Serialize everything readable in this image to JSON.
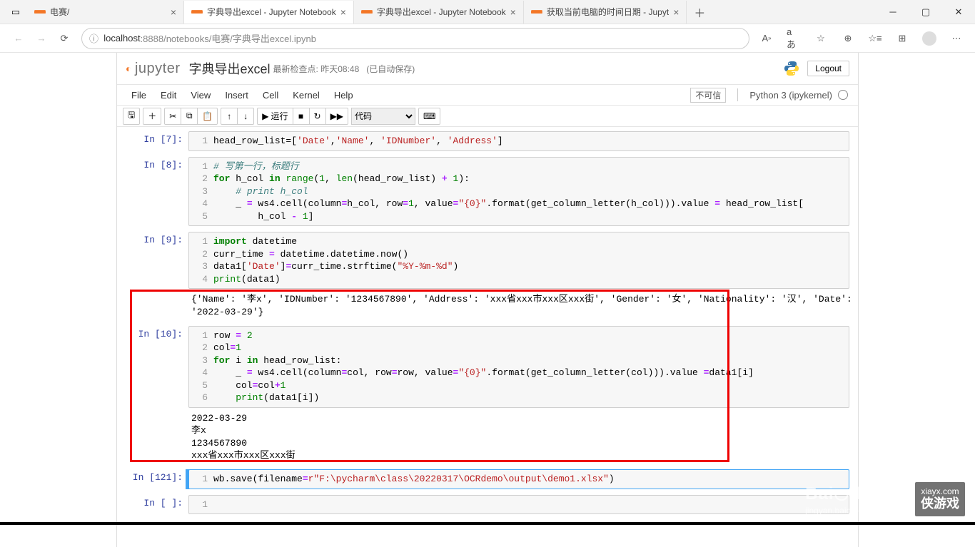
{
  "browser": {
    "tabs": [
      {
        "title": "电赛/",
        "active": false,
        "f": "#f37626"
      },
      {
        "title": "字典导出excel - Jupyter Notebook",
        "active": true,
        "f": "#f37626"
      },
      {
        "title": "字典导出excel - Jupyter Notebook",
        "active": false,
        "f": "#f37626"
      },
      {
        "title": "获取当前电脑的时间日期 - Jupyt",
        "active": false,
        "f": "#f37626"
      }
    ],
    "address_prefix": "localhost",
    "address_rest": ":8888/notebooks/电赛/字典导出excel.ipynb",
    "address_scheme_icon": "ⓘ"
  },
  "jupyter": {
    "brand": "jupyter",
    "notebook_name": "字典导出excel",
    "checkpoint_label": "最新检查点:",
    "checkpoint_time": "昨天08:48",
    "autosave": "(已自动保存)",
    "logout": "Logout",
    "trust": "不可信",
    "kernel": "Python 3 (ipykernel)"
  },
  "menus": [
    "File",
    "Edit",
    "View",
    "Insert",
    "Cell",
    "Kernel",
    "Help"
  ],
  "tools": {
    "run": "运行",
    "celltype": "代码"
  },
  "cells": [
    {
      "prompt": "In  [7]:",
      "type": "code",
      "lines": [
        {
          "n": "1",
          "html": "head_row_list=[<span class='cm-string'>'Date'</span>,<span class='cm-string'>'Name'</span>, <span class='cm-string'>'IDNumber'</span>, <span class='cm-string'>'Address'</span>]"
        }
      ]
    },
    {
      "prompt": "In  [8]:",
      "type": "code",
      "lines": [
        {
          "n": "1",
          "html": "<span class='cm-comment'># 写第一行，标题行</span>"
        },
        {
          "n": "2",
          "html": "<span class='cm-keyword'>for</span> h_col <span class='cm-keyword'>in</span> <span class='cm-builtin'>range</span>(<span class='cm-number'>1</span>, <span class='cm-builtin'>len</span>(head_row_list) <span class='cm-op'>+</span> <span class='cm-number'>1</span>):"
        },
        {
          "n": "3",
          "html": "    <span class='cm-comment'># print h_col</span>"
        },
        {
          "n": "4",
          "html": "    _ <span class='cm-op'>=</span> ws4.cell(column<span class='cm-op'>=</span>h_col, row<span class='cm-op'>=</span><span class='cm-number'>1</span>, value<span class='cm-op'>=</span><span class='cm-string'>\"{0}\"</span>.format(get_column_letter(h_col))).value <span class='cm-op'>=</span> head_row_list["
        },
        {
          "n": "5",
          "html": "        h_col <span class='cm-op'>-</span> <span class='cm-number'>1</span>]"
        }
      ]
    },
    {
      "prompt": "In  [9]:",
      "type": "code",
      "lines": [
        {
          "n": "1",
          "html": "<span class='cm-keyword'>import</span> datetime"
        },
        {
          "n": "2",
          "html": "curr_time <span class='cm-op'>=</span> datetime.datetime.now()"
        },
        {
          "n": "3",
          "html": "data1[<span class='cm-string'>'Date'</span>]<span class='cm-op'>=</span>curr_time.strftime(<span class='cm-string'>\"%Y-%m-%d\"</span>)"
        },
        {
          "n": "4",
          "html": "<span class='cm-builtin'>print</span>(data1)"
        }
      ],
      "output": "{'Name': '李x', 'IDNumber': '1234567890', 'Address': 'xxx省xxx市xxx区xxx街', 'Gender': '女', 'Nationality': '汉', 'Date': '2022-03-29'}"
    },
    {
      "prompt": "In [10]:",
      "type": "code",
      "lines": [
        {
          "n": "1",
          "html": "row <span class='cm-op'>=</span> <span class='cm-number'>2</span>"
        },
        {
          "n": "2",
          "html": "col<span class='cm-op'>=</span><span class='cm-number'>1</span>"
        },
        {
          "n": "3",
          "html": "<span class='cm-keyword'>for</span> i <span class='cm-keyword'>in</span> head_row_list:"
        },
        {
          "n": "4",
          "html": "    _ <span class='cm-op'>=</span> ws4.cell(column<span class='cm-op'>=</span>col, row<span class='cm-op'>=</span>row, value<span class='cm-op'>=</span><span class='cm-string'>\"{0}\"</span>.format(get_column_letter(col))).value <span class='cm-op'>=</span>data1[i]"
        },
        {
          "n": "5",
          "html": "    col<span class='cm-op'>=</span>col<span class='cm-op'>+</span><span class='cm-number'>1</span>"
        },
        {
          "n": "6",
          "html": "    <span class='cm-builtin'>print</span>(data1[i])"
        }
      ],
      "output": "2022-03-29\n李x\n1234567890\nxxx省xxx市xxx区xxx街"
    },
    {
      "prompt": "In [121]:",
      "type": "code",
      "selected": true,
      "lines": [
        {
          "n": "1",
          "html": "wb.save(filename<span class='cm-op'>=</span><span class='cm-string'>r\"F:\\pycharm\\class\\20220317\\OCRdemo\\output\\demo1.xlsx\"</span>)"
        }
      ]
    },
    {
      "prompt": "In  [ ]:",
      "type": "code",
      "lines": [
        {
          "n": "1",
          "html": ""
        }
      ]
    }
  ],
  "watermark": {
    "logo": "Baidu 经验",
    "url": "jingyan.baidu.com",
    "site": "xiayx.com",
    "brand": "侠游戏"
  }
}
